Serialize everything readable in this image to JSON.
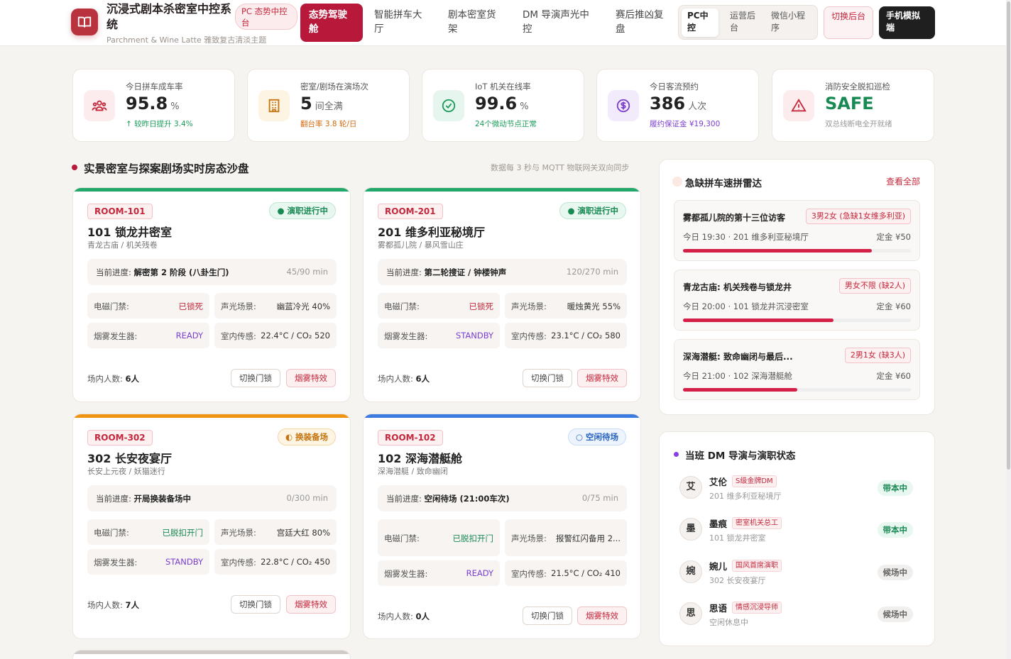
{
  "app": {
    "title": "沉浸式剧本杀密室中控系统",
    "subtitle": "Parchment & Wine Latte 雅致复古清淡主题",
    "badge": "PC 态势中控台"
  },
  "nav": [
    {
      "label": "态势驾驶舱",
      "active": true
    },
    {
      "label": "智能拼车大厅"
    },
    {
      "label": "剧本密室货架"
    },
    {
      "label": "DM 导演声光中控"
    },
    {
      "label": "赛后推凶复盘"
    }
  ],
  "view_switch": [
    {
      "label": "PC中控",
      "active": true
    },
    {
      "label": "运营后台"
    },
    {
      "label": "微信小程序"
    }
  ],
  "header_buttons": {
    "switch_backend": "切换后台",
    "mobile_sim": "手机模拟端"
  },
  "stats": [
    {
      "label": "今日拼车成车率",
      "value": "95.8",
      "unit": "%",
      "foot": "↑ 较昨日提升 3.4%",
      "foot_color": "#1a9c5a",
      "icon": "users-icon",
      "tint": "#fdecee",
      "icon_color": "#c3283c"
    },
    {
      "label": "密室/剧场在演场次",
      "value": "5",
      "unit": "间全满",
      "foot": "翻台率 3.8 轮/日",
      "foot_color": "#d26b10",
      "icon": "building-icon",
      "tint": "#fdf4e3",
      "icon_color": "#c5750f"
    },
    {
      "label": "IoT 机关在线率",
      "value": "99.6",
      "unit": "%",
      "foot": "24个微动节点正常",
      "foot_color": "#1a9c5a",
      "icon": "check-circle-icon",
      "tint": "#e6f6ee",
      "icon_color": "#1a9c5a"
    },
    {
      "label": "今日客流预约",
      "value": "386",
      "unit": "人次",
      "foot": "履约保证金 ¥19,300",
      "foot_color": "#7b3fd0",
      "icon": "dollar-icon",
      "tint": "#f2ebfc",
      "icon_color": "#7b3fd0"
    },
    {
      "label": "消防安全脱扣巡检",
      "value": "SAFE",
      "unit": "",
      "foot": "双总线断电全开就绪",
      "foot_color": "#999999",
      "icon": "warning-icon",
      "tint": "#fdecee",
      "icon_color": "#c3283c",
      "value_color": "#1a8a55"
    }
  ],
  "sandbox": {
    "title": "实景密室与探案剧场实时房态沙盘",
    "note": "数据每 3 秒与 MQTT 物联网关双向同步"
  },
  "labels": {
    "progress": "当前进度:",
    "door": "电磁门禁:",
    "sound": "声光场景:",
    "smoke": "烟雾发生器:",
    "sensor": "室内传感:",
    "people": "场内人数:",
    "btn_door": "切换门锁",
    "btn_smoke": "烟雾特效"
  },
  "rooms": [
    {
      "code": "ROOM-101",
      "status": "● 演职进行中",
      "status_kind": "live",
      "bar": "#22a86b",
      "name": "101 锁龙井密室",
      "sub": "青龙古庙 / 机关残卷",
      "progress": "解密第 2 阶段 (八卦生门)",
      "time": "45/90 min",
      "door": "已锁死",
      "door_color": "#c3283c",
      "sound": "幽蓝冷光 40%",
      "smoke": "READY",
      "sensor": "22.4°C / CO₂ 520",
      "people": "6人"
    },
    {
      "code": "ROOM-201",
      "status": "● 演职进行中",
      "status_kind": "live",
      "bar": "#22a86b",
      "name": "201 维多利亚秘境厅",
      "sub": "雾都孤儿院 / 暴风雪山庄",
      "progress": "第二轮搜证 / 钟楼钟声",
      "time": "120/270 min",
      "door": "已锁死",
      "door_color": "#c3283c",
      "sound": "暖烛黄光 55%",
      "smoke": "STANDBY",
      "sensor": "23.1°C / CO₂ 580",
      "people": "6人"
    },
    {
      "code": "ROOM-302",
      "status": "◐ 换装备场",
      "status_kind": "prep",
      "bar": "#ef9412",
      "name": "302 长安夜宴厅",
      "sub": "长安上元夜 / 妖猫迷行",
      "progress": "开局换装备场中",
      "time": "0/300 min",
      "door": "已脱扣开门",
      "door_color": "#1a8a55",
      "sound": "宫廷大红 80%",
      "smoke": "STANDBY",
      "sensor": "22.8°C / CO₂ 450",
      "people": "7人"
    },
    {
      "code": "ROOM-102",
      "status": "○ 空闲待场",
      "status_kind": "idle",
      "bar": "#3b7be0",
      "name": "102 深海潜艇舱",
      "sub": "深海潜艇 / 致命幽闭",
      "progress": "空闲待场 (21:00车次)",
      "time": "0/75 min",
      "door": "已脱扣开门",
      "door_color": "#1a8a55",
      "sound": "报警红闪备用 2...",
      "smoke": "READY",
      "sensor": "21.5°C / CO₂ 410",
      "people": "0人"
    }
  ],
  "radar": {
    "title": "急缺拼车速拼雷达",
    "view_all": "查看全部",
    "items": [
      {
        "name": "雾都孤儿院的第十三位访客",
        "tag": "3男2女 (急缺1女维多利亚)",
        "time": "今日 19:30 · 201 维多利亚秘境厅",
        "deposit": "定金 ¥50",
        "fill": 0.83
      },
      {
        "name": "青龙古庙: 机关残卷与锁龙井",
        "tag": "男女不限 (缺2人)",
        "time": "今日 20:00 · 101 锁龙井沉浸密室",
        "deposit": "定金 ¥60",
        "fill": 0.66
      },
      {
        "name": "深海潜艇: 致命幽闭与最后...",
        "tag": "2男1女 (缺3人)",
        "time": "今日 21:00 · 102 深海潜艇舱",
        "deposit": "定金 ¥60",
        "fill": 0.5
      }
    ]
  },
  "dm": {
    "title": "当班 DM 导演与演职状态",
    "items": [
      {
        "avatar": "艾",
        "name": "艾伦",
        "level": "S级金牌DM",
        "room": "201 维多利亚秘境厅",
        "status": "带本中",
        "kind": "busy"
      },
      {
        "avatar": "墨",
        "name": "墨痕",
        "level": "密室机关总工",
        "room": "101 锁龙井密室",
        "status": "带本中",
        "kind": "busy"
      },
      {
        "avatar": "婉",
        "name": "婉儿",
        "level": "国风首席演职",
        "room": "302 长安夜宴厅",
        "status": "候场中",
        "kind": "wait"
      },
      {
        "avatar": "思",
        "name": "思语",
        "level": "情感沉浸导师",
        "room": "空闲休息中",
        "status": "候场中",
        "kind": "wait"
      }
    ]
  }
}
